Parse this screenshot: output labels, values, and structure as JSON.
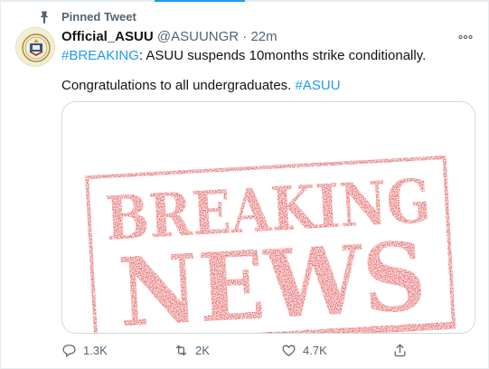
{
  "pinned": {
    "label": "Pinned Tweet",
    "icon": "pin-icon"
  },
  "tweet": {
    "display_name": "Official_ASUU",
    "handle": "@ASUUNGR",
    "separator": "·",
    "time": "22m",
    "line1_hashtag": "#BREAKING",
    "line1_text": ": ASUU suspends 10months strike conditionally.",
    "line2_text": "Congratulations to all undergraduates. ",
    "line2_hashtag": "#ASUU"
  },
  "media": {
    "stamp_line1": "BREAKING",
    "stamp_line2": "NEWS",
    "stamp_color": "#d92b2b"
  },
  "actions": {
    "reply_count": "1.3K",
    "retweet_count": "2K",
    "like_count": "4.7K"
  },
  "colors": {
    "accent": "#1d9bf0",
    "secondary_text": "#536471"
  }
}
